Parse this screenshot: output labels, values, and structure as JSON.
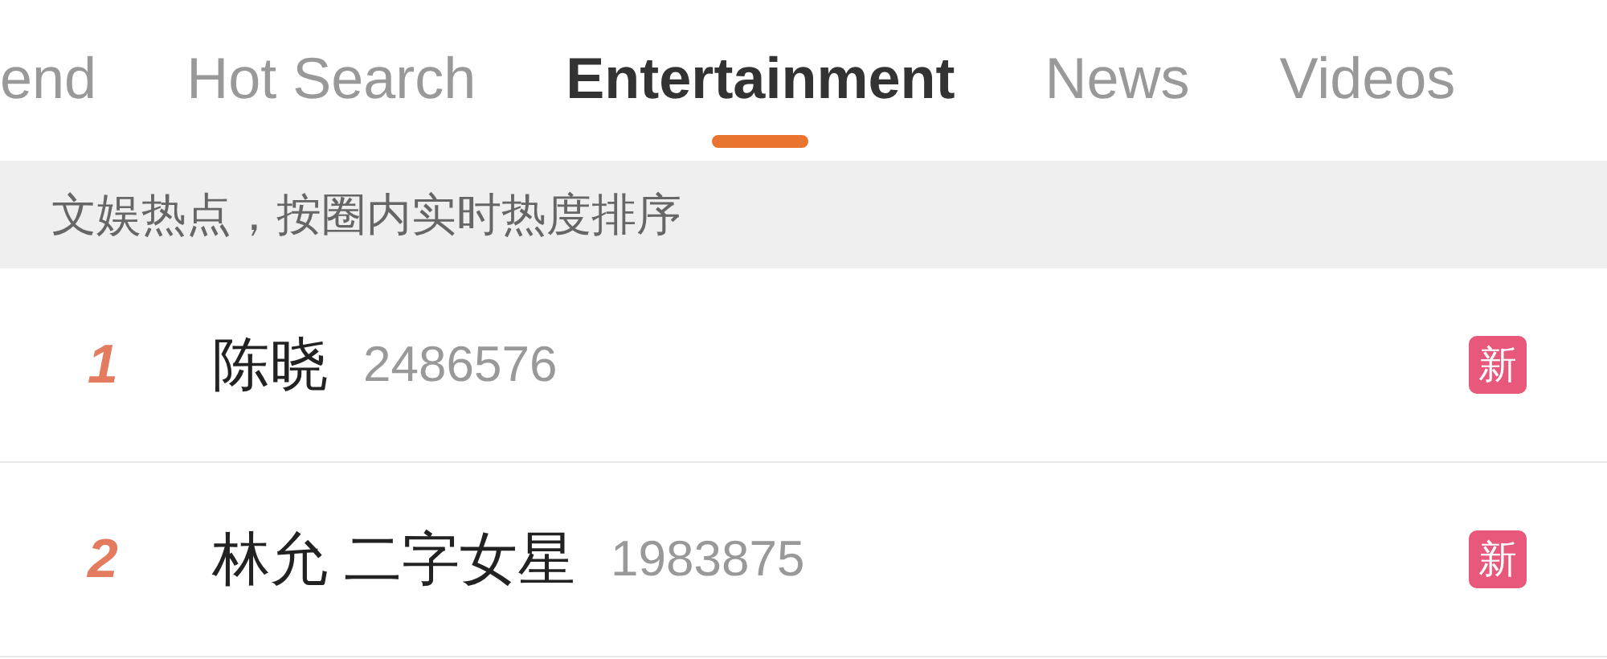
{
  "tabs": [
    {
      "label": "end",
      "selected": false
    },
    {
      "label": "Hot Search",
      "selected": false
    },
    {
      "label": "Entertainment",
      "selected": true
    },
    {
      "label": "News",
      "selected": false
    },
    {
      "label": "Videos",
      "selected": false
    }
  ],
  "banner": "文娱热点，按圈内实时热度排序",
  "items": [
    {
      "rank": "1",
      "title": "陈晓",
      "count": "2486576",
      "badge": "新"
    },
    {
      "rank": "2",
      "title": "林允 二字女星",
      "count": "1983875",
      "badge": "新"
    }
  ]
}
